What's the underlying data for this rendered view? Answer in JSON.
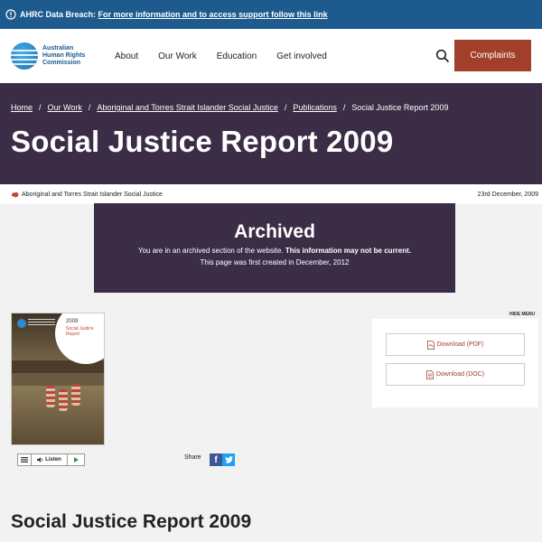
{
  "alert": {
    "title": "AHRC Data Breach:",
    "link": "For more information and to access support follow this link"
  },
  "header": {
    "logo_text": "Australian Human Rights Commission",
    "nav": [
      "About",
      "Our Work",
      "Education",
      "Get involved"
    ],
    "complaints_label": "Complaints"
  },
  "breadcrumb": {
    "items": [
      "Home",
      "Our Work",
      "Aboriginal and Torres Strait Islander Social Justice",
      "Publications"
    ],
    "current": "Social Justice Report 2009",
    "separator": "/"
  },
  "page": {
    "title": "Social Justice Report 2009",
    "category_tag": "Aboriginal and Torres Strait Islander Social Justice",
    "date": "23rd December, 2009"
  },
  "archived": {
    "heading": "Archived",
    "line1_pre": "You are in an archived section of the website. ",
    "line1_bold": "This information may not be current.",
    "line2": "This page was first created in December, 2012"
  },
  "cover": {
    "year": "2009",
    "title1": "Social Justice",
    "title2": "Report"
  },
  "listen": {
    "label": "Listen"
  },
  "share": {
    "label": "Share",
    "facebook": "f"
  },
  "sidebar": {
    "hide_menu": "HIDE MENU",
    "downloads": [
      "Download (PDF)",
      "Download (DOC)"
    ]
  },
  "content": {
    "heading": "Social Justice Report 2009"
  },
  "colors": {
    "alert_bg": "#1d5a8e",
    "hero_bg": "#3b2d46",
    "accent": "#a23f2a"
  }
}
